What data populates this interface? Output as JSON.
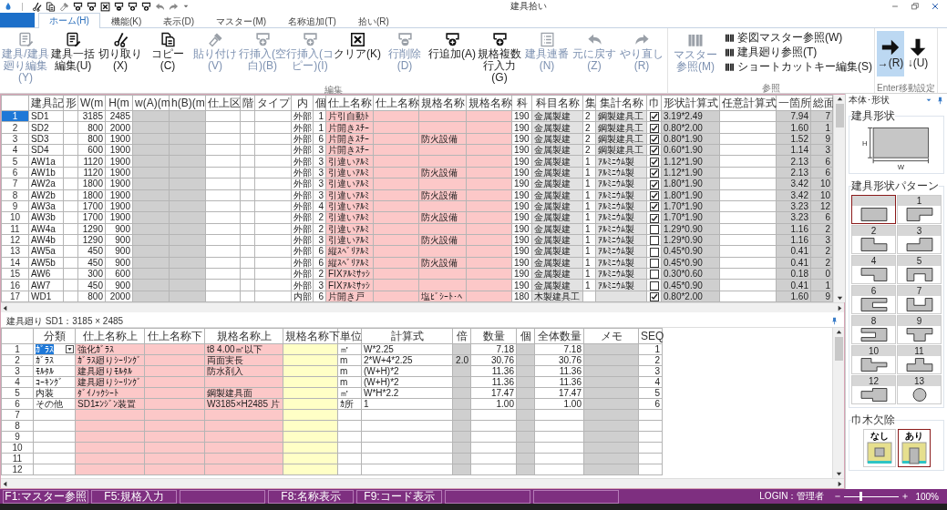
{
  "window": {
    "title": "建具拾い"
  },
  "tabs": [
    {
      "label": "ホーム(H)",
      "selected": true
    },
    {
      "label": "機能(K)",
      "selected": false
    },
    {
      "label": "表示(D)",
      "selected": false
    },
    {
      "label": "マスター(M)",
      "selected": false
    },
    {
      "label": "名称追加(T)",
      "selected": false
    },
    {
      "label": "拾い(R)",
      "selected": false
    }
  ],
  "ribbon": {
    "groups": [
      {
        "kind": "large",
        "label": "編集",
        "buttons": [
          {
            "label": "建具/建具廻り編集(Y)",
            "disabled": true
          },
          {
            "label": "建具一括編集(U)",
            "disabled": false
          },
          {
            "label": "切り取り(X)",
            "disabled": false
          },
          {
            "label": "コピー(C)",
            "disabled": false
          },
          {
            "label": "貼り付け(V)",
            "disabled": true
          },
          {
            "label": "行挿入(空白)(B)",
            "disabled": true
          },
          {
            "label": "行挿入(コピー)(I)",
            "disabled": true
          },
          {
            "label": "クリア(K)",
            "disabled": false
          },
          {
            "label": "行削除(D)",
            "disabled": true
          },
          {
            "label": "行追加(A)",
            "disabled": false
          },
          {
            "label": "規格複数行入力(G)",
            "disabled": false
          },
          {
            "label": "建具連番(N)",
            "disabled": true
          },
          {
            "label": "元に戻す(Z)",
            "disabled": true
          },
          {
            "label": "やり直し(R)",
            "disabled": true
          }
        ]
      },
      {
        "kind": "reference",
        "label": "参照",
        "buttons": [
          {
            "label": "マスター参照(M)",
            "disabled": true
          }
        ],
        "links": [
          "姿図マスター参照(W)",
          "建具廻り参照(T)",
          "ショートカットキー編集(S)"
        ]
      },
      {
        "kind": "toggle",
        "label": "Enter移動設定",
        "buttons": [
          {
            "label": "→(R)",
            "selected": true
          },
          {
            "label": "↓(U)",
            "selected": false
          }
        ]
      }
    ]
  },
  "top_grid": {
    "columns": [
      {
        "label": "建具記",
        "kind": "text"
      },
      {
        "label": "形",
        "kind": "text"
      },
      {
        "label": "W(m",
        "kind": "number"
      },
      {
        "label": "H(m",
        "kind": "number"
      },
      {
        "label": "w(A)(m",
        "kind": "number"
      },
      {
        "label": "h(B)(m",
        "kind": "number"
      },
      {
        "label": "仕上区",
        "kind": "text"
      },
      {
        "label": "階",
        "kind": "text"
      },
      {
        "label": "タイプ",
        "kind": "text"
      },
      {
        "label": "内",
        "kind": "text"
      },
      {
        "label": "個",
        "kind": "number"
      },
      {
        "label": "仕上名称",
        "kind": "text"
      },
      {
        "label": "仕上名称",
        "kind": "text"
      },
      {
        "label": "規格名称",
        "kind": "text"
      },
      {
        "label": "規格名称",
        "kind": "text"
      },
      {
        "label": "科",
        "kind": "text"
      },
      {
        "label": "科目名称",
        "kind": "text"
      },
      {
        "label": "集",
        "kind": "text"
      },
      {
        "label": "集計名称",
        "kind": "text"
      },
      {
        "label": "巾",
        "kind": "check"
      },
      {
        "label": "形状計算式",
        "kind": "text"
      },
      {
        "label": "任意計算式",
        "kind": "text"
      },
      {
        "label": "一箇所",
        "kind": "number"
      },
      {
        "label": "総面",
        "kind": "number"
      }
    ],
    "rows": [
      {
        "number": "1",
        "selected": true,
        "cells": [
          "SD1",
          null,
          "3185",
          "2485",
          null,
          null,
          null,
          null,
          null,
          "外部",
          "1",
          "片引自動ﾄ",
          null,
          null,
          null,
          "190",
          "金属製建",
          "2",
          "鋼製建具工",
          true,
          "3.19*2.49",
          null,
          "7.94",
          "7"
        ]
      },
      {
        "number": "2",
        "selected": false,
        "cells": [
          "SD2",
          null,
          "800",
          "2000",
          null,
          null,
          null,
          null,
          null,
          "外部",
          "1",
          "片開きｽﾁｰ",
          null,
          null,
          null,
          "190",
          "金属製建",
          "2",
          "鋼製建具工",
          true,
          "0.80*2.00",
          null,
          "1.60",
          "1"
        ]
      },
      {
        "number": "3",
        "selected": false,
        "cells": [
          "SD3",
          null,
          "800",
          "1900",
          null,
          null,
          null,
          null,
          null,
          "外部",
          "6",
          "片開きｽﾁｰ",
          null,
          "防火設備",
          null,
          "190",
          "金属製建",
          "2",
          "鋼製建具工",
          true,
          "0.80*1.90",
          null,
          "1.52",
          "9"
        ]
      },
      {
        "number": "4",
        "selected": false,
        "cells": [
          "SD4",
          null,
          "600",
          "1900",
          null,
          null,
          null,
          null,
          null,
          "外部",
          "3",
          "片開きｽﾁｰ",
          null,
          null,
          null,
          "190",
          "金属製建",
          "2",
          "鋼製建具工",
          true,
          "0.60*1.90",
          null,
          "1.14",
          "3"
        ]
      },
      {
        "number": "5",
        "selected": false,
        "cells": [
          "AW1a",
          null,
          "1120",
          "1900",
          null,
          null,
          null,
          null,
          null,
          "外部",
          "3",
          "引違いｱﾙﾐ",
          null,
          null,
          null,
          "190",
          "金属製建",
          "1",
          "ｱﾙﾐﾆｳﾑ製",
          true,
          "1.12*1.90",
          null,
          "2.13",
          "6"
        ]
      },
      {
        "number": "6",
        "selected": false,
        "cells": [
          "AW1b",
          null,
          "1120",
          "1900",
          null,
          null,
          null,
          null,
          null,
          "外部",
          "3",
          "引違いｱﾙﾐ",
          null,
          "防火設備",
          null,
          "190",
          "金属製建",
          "1",
          "ｱﾙﾐﾆｳﾑ製",
          true,
          "1.12*1.90",
          null,
          "2.13",
          "6"
        ]
      },
      {
        "number": "7",
        "selected": false,
        "cells": [
          "AW2a",
          null,
          "1800",
          "1900",
          null,
          null,
          null,
          null,
          null,
          "外部",
          "3",
          "引違いｱﾙﾐ",
          null,
          null,
          null,
          "190",
          "金属製建",
          "1",
          "ｱﾙﾐﾆｳﾑ製",
          true,
          "1.80*1.90",
          null,
          "3.42",
          "10"
        ]
      },
      {
        "number": "8",
        "selected": false,
        "cells": [
          "AW2b",
          null,
          "1800",
          "1900",
          null,
          null,
          null,
          null,
          null,
          "外部",
          "3",
          "引違いｱﾙﾐ",
          null,
          "防火設備",
          null,
          "190",
          "金属製建",
          "1",
          "ｱﾙﾐﾆｳﾑ製",
          true,
          "1.80*1.90",
          null,
          "3.42",
          "10"
        ]
      },
      {
        "number": "9",
        "selected": false,
        "cells": [
          "AW3a",
          null,
          "1700",
          "1900",
          null,
          null,
          null,
          null,
          null,
          "外部",
          "4",
          "引違いｱﾙﾐ",
          null,
          null,
          null,
          "190",
          "金属製建",
          "1",
          "ｱﾙﾐﾆｳﾑ製",
          true,
          "1.70*1.90",
          null,
          "3.23",
          "12"
        ]
      },
      {
        "number": "10",
        "selected": false,
        "cells": [
          "AW3b",
          null,
          "1700",
          "1900",
          null,
          null,
          null,
          null,
          null,
          "外部",
          "2",
          "引違いｱﾙﾐ",
          null,
          "防火設備",
          null,
          "190",
          "金属製建",
          "1",
          "ｱﾙﾐﾆｳﾑ製",
          true,
          "1.70*1.90",
          null,
          "3.23",
          "6"
        ]
      },
      {
        "number": "11",
        "selected": false,
        "cells": [
          "AW4a",
          null,
          "1290",
          "900",
          null,
          null,
          null,
          null,
          null,
          "外部",
          "2",
          "引違いｱﾙﾐ",
          null,
          null,
          null,
          "190",
          "金属製建",
          "1",
          "ｱﾙﾐﾆｳﾑ製",
          false,
          "1.29*0.90",
          null,
          "1.16",
          "2"
        ]
      },
      {
        "number": "12",
        "selected": false,
        "cells": [
          "AW4b",
          null,
          "1290",
          "900",
          null,
          null,
          null,
          null,
          null,
          "外部",
          "3",
          "引違いｱﾙﾐ",
          null,
          "防火設備",
          null,
          "190",
          "金属製建",
          "1",
          "ｱﾙﾐﾆｳﾑ製",
          false,
          "1.29*0.90",
          null,
          "1.16",
          "3"
        ]
      },
      {
        "number": "13",
        "selected": false,
        "cells": [
          "AW5a",
          null,
          "450",
          "900",
          null,
          null,
          null,
          null,
          null,
          "外部",
          "6",
          "縦ｽﾍﾞﾘｱﾙﾐ",
          null,
          null,
          null,
          "190",
          "金属製建",
          "1",
          "ｱﾙﾐﾆｳﾑ製",
          false,
          "0.45*0.90",
          null,
          "0.41",
          "2"
        ]
      },
      {
        "number": "14",
        "selected": false,
        "cells": [
          "AW5b",
          null,
          "450",
          "900",
          null,
          null,
          null,
          null,
          null,
          "外部",
          "6",
          "縦ｽﾍﾞﾘｱﾙﾐ",
          null,
          "防火設備",
          null,
          "190",
          "金属製建",
          "1",
          "ｱﾙﾐﾆｳﾑ製",
          false,
          "0.45*0.90",
          null,
          "0.41",
          "2"
        ]
      },
      {
        "number": "15",
        "selected": false,
        "cells": [
          "AW6",
          null,
          "300",
          "600",
          null,
          null,
          null,
          null,
          null,
          "外部",
          "2",
          "FIXｱﾙﾐｻｯｼ",
          null,
          null,
          null,
          "190",
          "金属製建",
          "1",
          "ｱﾙﾐﾆｳﾑ製",
          false,
          "0.30*0.60",
          null,
          "0.18",
          "0"
        ]
      },
      {
        "number": "16",
        "selected": false,
        "cells": [
          "AW7",
          null,
          "450",
          "900",
          null,
          null,
          null,
          null,
          null,
          "外部",
          "3",
          "FIXｱﾙﾐｻｯｼ",
          null,
          null,
          null,
          "190",
          "金属製建",
          "1",
          "ｱﾙﾐﾆｳﾑ製",
          false,
          "0.45*0.90",
          null,
          "0.41",
          "1"
        ]
      },
      {
        "number": "17",
        "selected": false,
        "cells": [
          "WD1",
          null,
          "800",
          "2000",
          null,
          null,
          null,
          null,
          null,
          "内部",
          "6",
          "片開き戸",
          null,
          "塩ﾋﾞｼｰﾄ･ﾍ",
          null,
          "180",
          "木製建具工",
          null,
          null,
          true,
          "0.80*2.00",
          null,
          "1.60",
          "9"
        ]
      }
    ]
  },
  "bottom_grid": {
    "title": "建具廻り SD1：3185 × 2485",
    "columns": [
      {
        "label": "分類",
        "kind": "text"
      },
      {
        "label": "仕上名称上",
        "kind": "text"
      },
      {
        "label": "仕上名称下",
        "kind": "text"
      },
      {
        "label": "規格名称上",
        "kind": "text"
      },
      {
        "label": "規格名称下",
        "kind": "text"
      },
      {
        "label": "単位",
        "kind": "text"
      },
      {
        "label": "計算式",
        "kind": "text"
      },
      {
        "label": "倍",
        "kind": "number"
      },
      {
        "label": "数量",
        "kind": "number"
      },
      {
        "label": "個",
        "kind": "number"
      },
      {
        "label": "全体数量",
        "kind": "number"
      },
      {
        "label": "メモ",
        "kind": "text"
      },
      {
        "label": "SEQ",
        "kind": "number"
      }
    ],
    "rows": [
      {
        "number": "1",
        "selected": true,
        "cells": [
          "ｶﾞﾗｽ",
          "強化ｶﾞﾗｽ",
          null,
          "t8 4.00㎡以下",
          null,
          "㎡",
          "W*2.25",
          null,
          "7.18",
          null,
          "7.18",
          null,
          "1"
        ]
      },
      {
        "number": "2",
        "selected": false,
        "cells": [
          "ｶﾞﾗｽ",
          "ｶﾞﾗｽ廻りｼｰﾘﾝｸﾞ",
          null,
          "両面実長",
          null,
          "m",
          "2*W+4*2.25",
          "2.0",
          "30.76",
          null,
          "30.76",
          null,
          "2"
        ]
      },
      {
        "number": "3",
        "selected": false,
        "cells": [
          "ﾓﾙﾀﾙ",
          "建具廻りﾓﾙﾀﾙ",
          null,
          "防水剤入",
          null,
          "m",
          "(W+H)*2",
          null,
          "11.36",
          null,
          "11.36",
          null,
          "3"
        ]
      },
      {
        "number": "4",
        "selected": false,
        "cells": [
          "ｺｰｷﾝｸﾞ",
          "建具廻りｼｰﾘﾝｸﾞ",
          null,
          null,
          null,
          "m",
          "(W+H)*2",
          null,
          "11.36",
          null,
          "11.36",
          null,
          "4"
        ]
      },
      {
        "number": "5",
        "selected": false,
        "cells": [
          "内装",
          "ﾀﾞｲﾉｯｸｼｰﾄ",
          null,
          "鋼製建具面",
          null,
          "㎡",
          "W*H*2.2",
          null,
          "17.47",
          null,
          "17.47",
          null,
          "5"
        ]
      },
      {
        "number": "6",
        "selected": false,
        "cells": [
          "その他",
          "SD1ｴﾝｼﾞﾝ装置",
          null,
          "W3185×H2485 片",
          null,
          "ｶ所",
          "1",
          null,
          "1.00",
          null,
          "1.00",
          null,
          "6"
        ]
      },
      {
        "number": "7",
        "selected": false
      },
      {
        "number": "8",
        "selected": false
      },
      {
        "number": "9",
        "selected": false
      },
      {
        "number": "10",
        "selected": false
      },
      {
        "number": "11",
        "selected": false
      },
      {
        "number": "12",
        "selected": false
      }
    ]
  },
  "side_panel": {
    "title": "本体･形状",
    "shape": {
      "label": "建具形状",
      "height_label": "H",
      "width_label": "W"
    },
    "patterns": {
      "label": "建具形状パターン",
      "items": [
        {
          "selected": true
        },
        {
          "label": "1",
          "selected": false
        },
        {
          "label": "2",
          "selected": false
        },
        {
          "label": "3",
          "selected": false
        },
        {
          "label": "4",
          "selected": false
        },
        {
          "label": "5",
          "selected": false
        },
        {
          "label": "6",
          "selected": false
        },
        {
          "label": "7",
          "selected": false
        },
        {
          "label": "8",
          "selected": false
        },
        {
          "label": "9",
          "selected": false
        },
        {
          "label": "10",
          "selected": false
        },
        {
          "label": "11",
          "selected": false
        },
        {
          "label": "12",
          "selected": false
        },
        {
          "label": "13",
          "selected": false
        }
      ]
    },
    "baseboard": {
      "label": "巾木欠除",
      "options": [
        {
          "label": "なし",
          "selected": false
        },
        {
          "label": "あり",
          "selected": true
        }
      ]
    }
  },
  "status_bar": {
    "keys": [
      {
        "kind": "key",
        "label": "F1:マスター参照"
      },
      {
        "kind": "key",
        "label": "F5:規格入力"
      },
      {
        "kind": "blank"
      },
      {
        "kind": "key",
        "label": "F8:名称表示"
      },
      {
        "kind": "key",
        "label": "F9:コード表示"
      },
      {
        "kind": "blank"
      },
      {
        "kind": "blank"
      }
    ],
    "login": "LOGIN：管理者",
    "zoom": {
      "level": 0.3,
      "reading": "100%"
    }
  }
}
